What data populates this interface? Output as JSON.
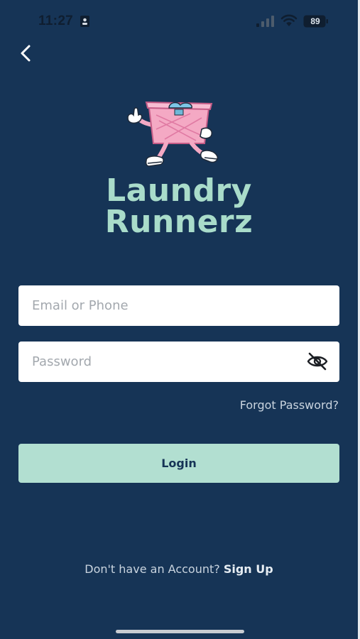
{
  "status_bar": {
    "time": "11:27",
    "battery": "89",
    "icons": [
      "id-card-icon",
      "signal-icon",
      "wifi-icon",
      "battery-icon"
    ]
  },
  "nav": {
    "back_icon": "chevron-left-icon"
  },
  "brand": {
    "line1": "Laundry",
    "line2": "Runnerz",
    "logo_icon": "laundry-basket-mascot-icon"
  },
  "form": {
    "email_placeholder": "Email or Phone",
    "email_value": "",
    "password_placeholder": "Password",
    "password_value": "",
    "password_toggle_icon": "eye-off-icon",
    "forgot_password": "Forgot Password?",
    "login_label": "Login"
  },
  "signup": {
    "prompt": "Don't have an Account? ",
    "link": "Sign Up"
  },
  "colors": {
    "background": "#163456",
    "accent": "#b2dfd1",
    "brand_text": "#a9dcca",
    "basket_pink": "#f4a9c4"
  }
}
